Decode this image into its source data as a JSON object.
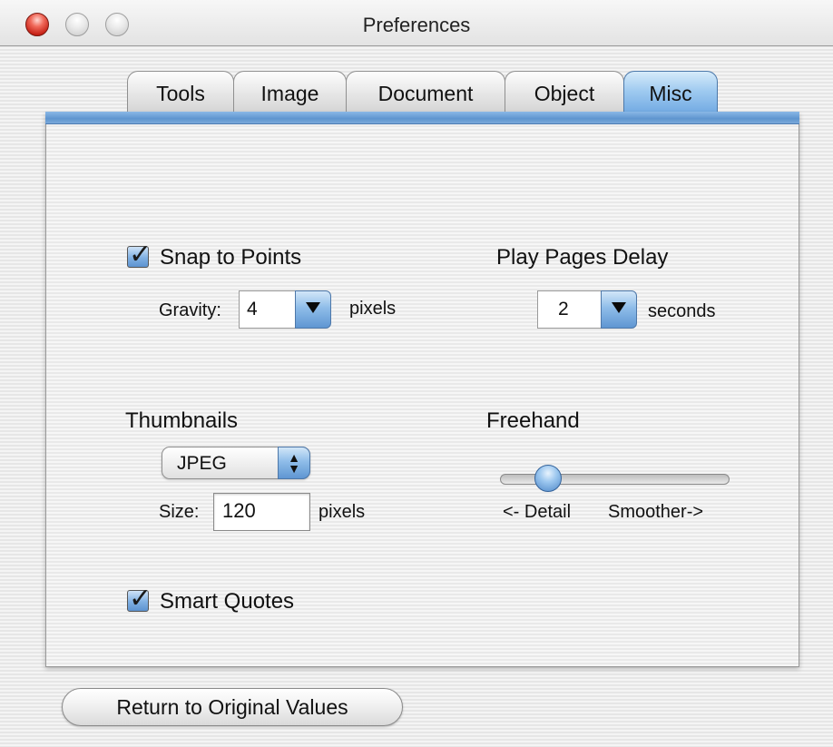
{
  "window": {
    "title": "Preferences"
  },
  "tabs": [
    {
      "label": "Tools",
      "selected": false
    },
    {
      "label": "Image",
      "selected": false
    },
    {
      "label": "Document",
      "selected": false
    },
    {
      "label": "Object",
      "selected": false
    },
    {
      "label": "Misc",
      "selected": true
    }
  ],
  "snap_to_points": {
    "label": "Snap to Points",
    "checked": true,
    "gravity_label": "Gravity:",
    "gravity_value": "4",
    "gravity_unit": "pixels"
  },
  "play_pages_delay": {
    "label": "Play Pages Delay",
    "value": "2",
    "unit": "seconds"
  },
  "thumbnails": {
    "label": "Thumbnails",
    "format": "JPEG",
    "size_label": "Size:",
    "size_value": "120",
    "size_unit": "pixels"
  },
  "freehand": {
    "label": "Freehand",
    "min_label": "<- Detail",
    "max_label": "Smoother->",
    "value_fraction": 0.17
  },
  "smart_quotes": {
    "label": "Smart Quotes",
    "checked": true
  },
  "footer": {
    "return_button_label": "Return to Original Values"
  },
  "colors": {
    "accent": "#6fa8e2",
    "close_button": "#d9342a"
  }
}
